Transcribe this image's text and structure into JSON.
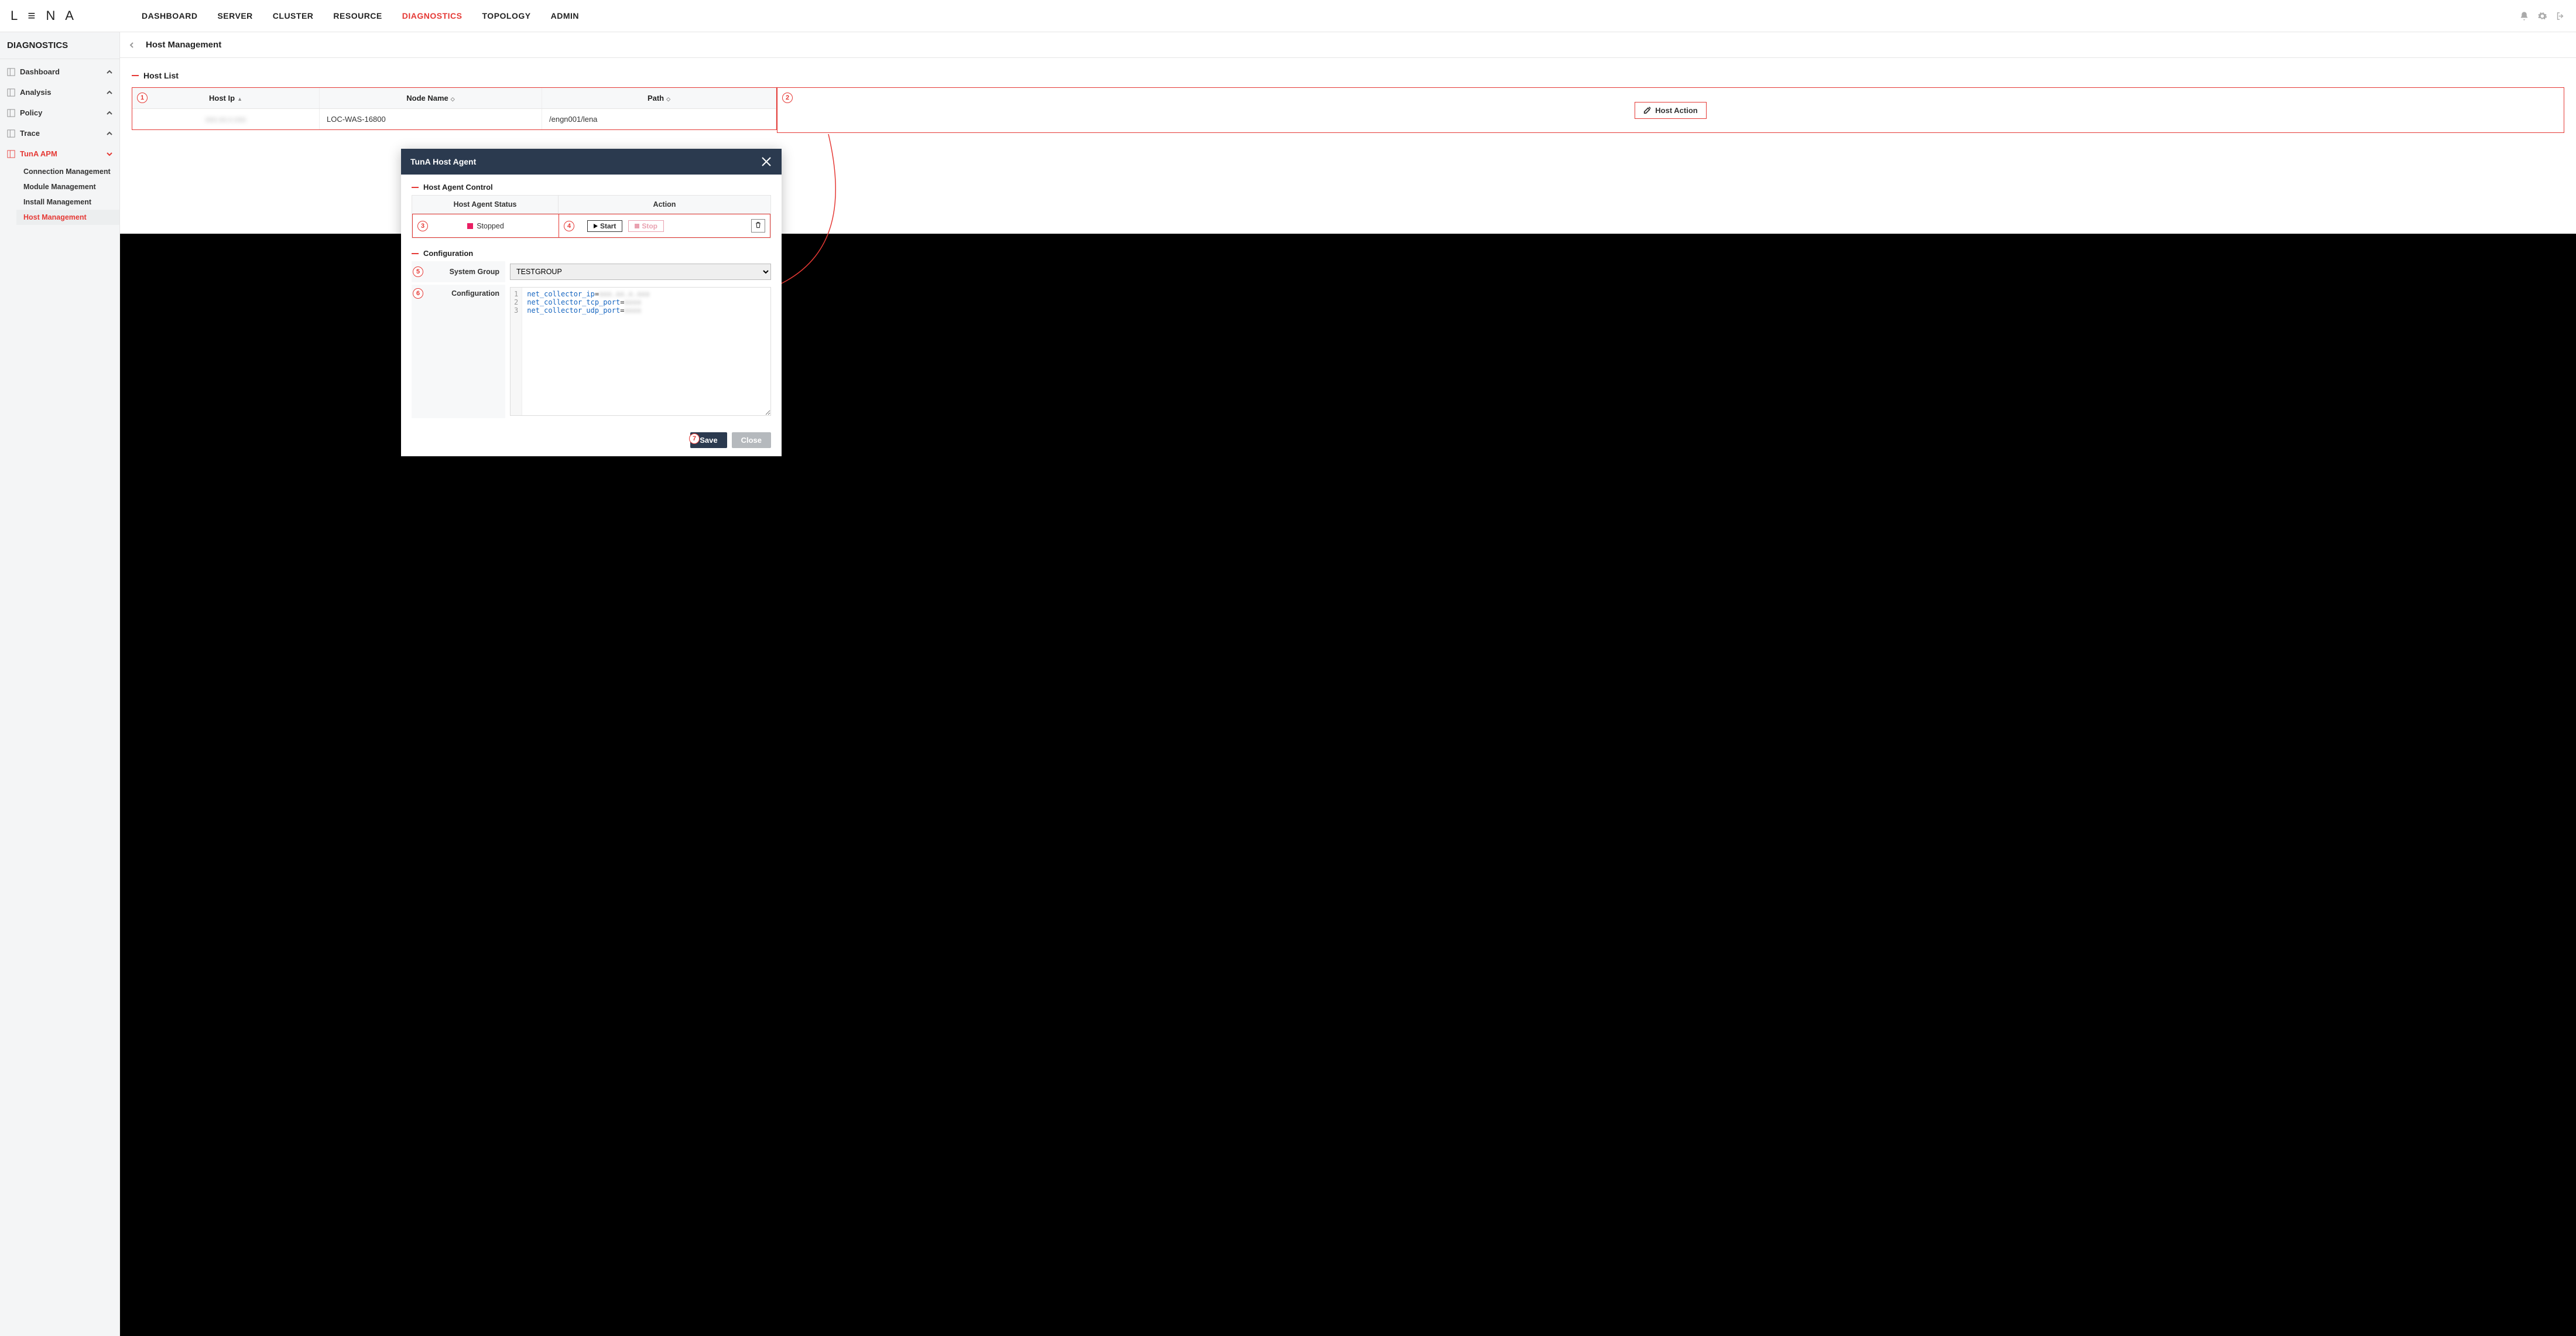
{
  "logo_text": "L ≡ N A",
  "topnav": {
    "items": [
      "DASHBOARD",
      "SERVER",
      "CLUSTER",
      "RESOURCE",
      "DIAGNOSTICS",
      "TOPOLOGY",
      "ADMIN"
    ],
    "active_index": 4
  },
  "sidebar": {
    "title": "DIAGNOSTICS",
    "groups": [
      {
        "label": "Dashboard",
        "expanded": false
      },
      {
        "label": "Analysis",
        "expanded": false
      },
      {
        "label": "Policy",
        "expanded": false
      },
      {
        "label": "Trace",
        "expanded": false
      },
      {
        "label": "TunA APM",
        "expanded": true,
        "active": true,
        "children": [
          {
            "label": "Connection Management"
          },
          {
            "label": "Module Management"
          },
          {
            "label": "Install Management"
          },
          {
            "label": "Host Management",
            "active": true
          }
        ]
      }
    ]
  },
  "page": {
    "title": "Host Management",
    "section_title": "Host List",
    "columns": {
      "host_ip": "Host Ip",
      "node_name": "Node Name",
      "path": "Path"
    },
    "row": {
      "host_ip": "xxx.xx.x.xxx",
      "node_name": "LOC-WAS-16800",
      "path": "/engn001/lena"
    },
    "host_action_label": "Host Action"
  },
  "modal": {
    "title": "TunA Host Agent",
    "control_title": "Host Agent Control",
    "status_header": "Host Agent Status",
    "action_header": "Action",
    "status_value": "Stopped",
    "start_label": "Start",
    "stop_label": "Stop",
    "config_title": "Configuration",
    "system_group_label": "System Group",
    "system_group_value": "TESTGROUP",
    "configuration_label": "Configuration",
    "config_lines": [
      {
        "key": "net_collector_ip",
        "val": "xxx.xx.x.xxx"
      },
      {
        "key": "net_collector_tcp_port",
        "val": "xxxx"
      },
      {
        "key": "net_collector_udp_port",
        "val": "xxxx"
      }
    ],
    "save_label": "Save",
    "close_label": "Close"
  },
  "annotations": [
    "1",
    "2",
    "3",
    "4",
    "5",
    "6",
    "7"
  ]
}
